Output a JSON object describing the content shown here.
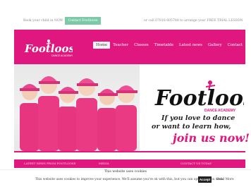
{
  "topbar": {
    "book_text": "Book your child in NOW",
    "contact_button": "Contact Footloose",
    "call_text": "or call 07818 605788 to arrange your FREE TRIAL LESSON"
  },
  "nav": {
    "logo_alt": "Footloose",
    "logo_sub": "DANCE ACADEMY",
    "items": [
      {
        "label": "Home",
        "active": true
      },
      {
        "label": "Teacher",
        "active": false
      },
      {
        "label": "Classes",
        "active": false
      },
      {
        "label": "Timetable",
        "active": false
      },
      {
        "label": "Latest news",
        "active": false
      },
      {
        "label": "Gallery",
        "active": false
      },
      {
        "label": "Contact",
        "active": false
      }
    ]
  },
  "hero": {
    "brand": "Footloose",
    "brand_sub": "DANCE ACADEMY",
    "line1": "If you love to dance",
    "line2": "or want to learn how,",
    "line3": "join us now!"
  },
  "footer_strip": {
    "col1": "LATEST NEWS FROM FOOTLOOSE",
    "col2": "MEDIA",
    "col3": "CONTACT US TODAY"
  },
  "cookie": {
    "title": "This website uses cookies",
    "message": "This website uses cookies to improve your experience. We'll assume you're ok with this, but you can opt-out if you wish.",
    "accept": "Accept",
    "read_more": "Read More"
  },
  "colors": {
    "brand_pink": "#e0177f",
    "accent_green": "#7cc9a8"
  }
}
